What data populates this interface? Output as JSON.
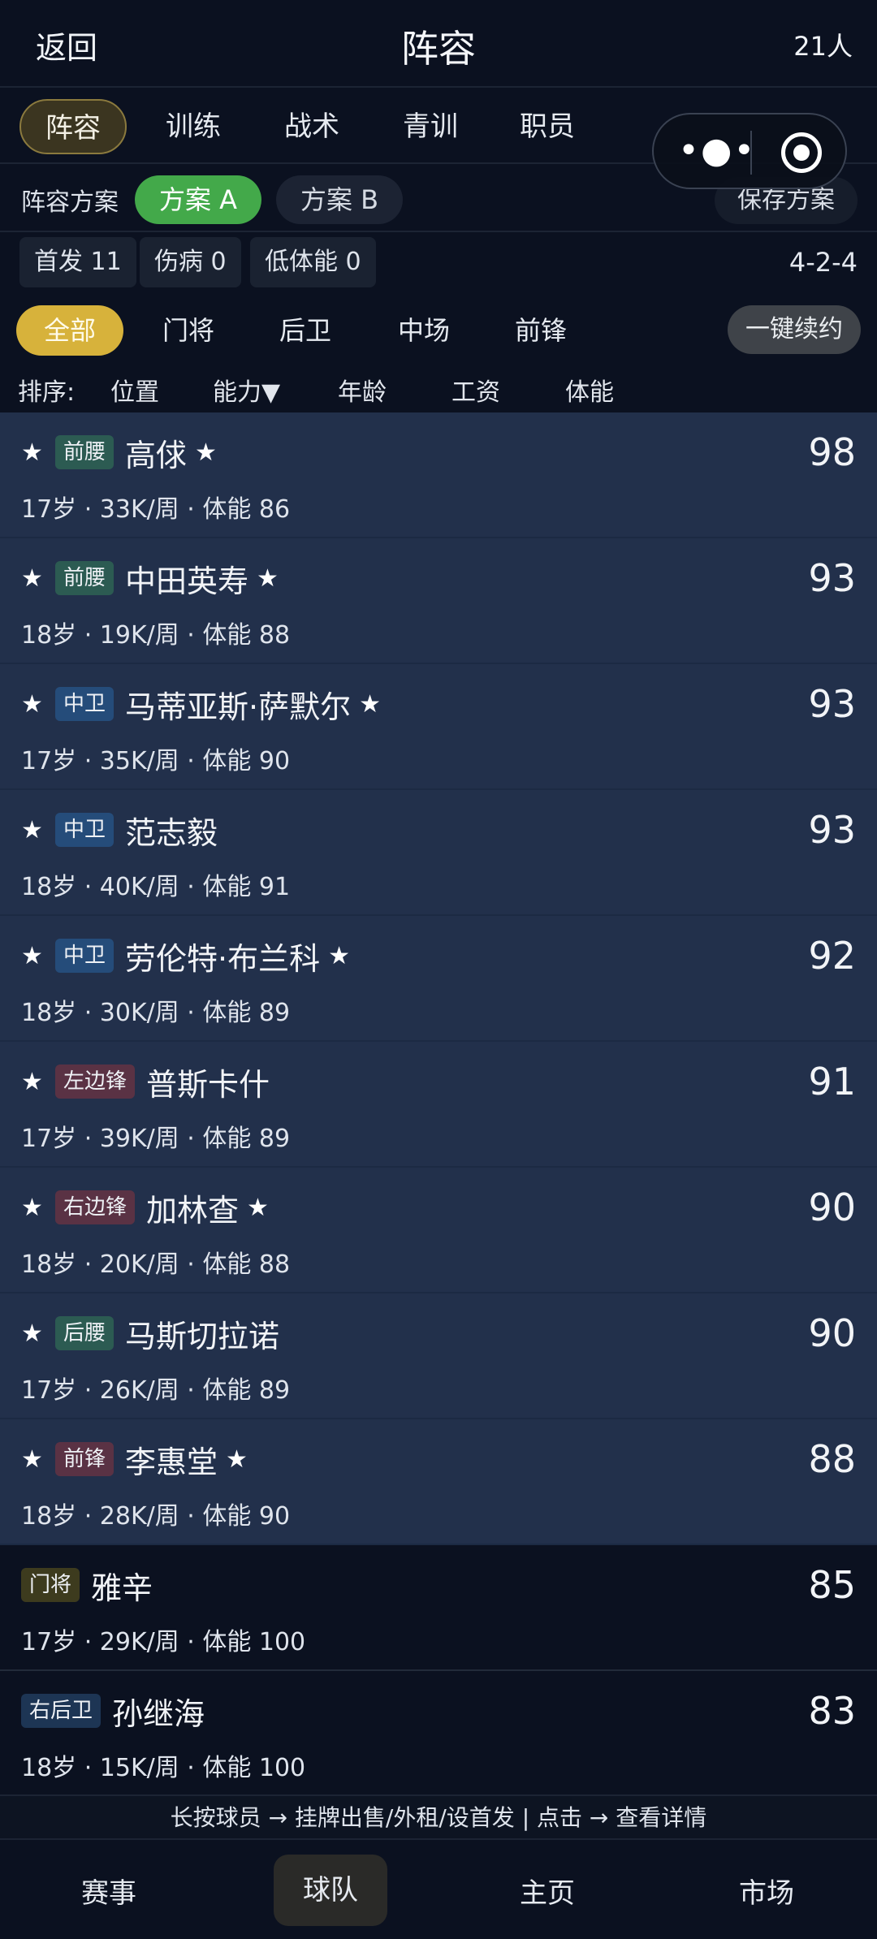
{
  "header": {
    "back_label": "返回",
    "title": "阵容",
    "count": "21人"
  },
  "tabs": [
    {
      "label": "阵容",
      "active": true
    },
    {
      "label": "训练"
    },
    {
      "label": "战术"
    },
    {
      "label": "青训"
    },
    {
      "label": "职员"
    }
  ],
  "plan": {
    "label": "阵容方案",
    "plan_a": "方案 A",
    "plan_b": "方案 B",
    "save": "保存方案"
  },
  "stats": {
    "starters": "首发 11",
    "injured": "伤病 0",
    "low_stamina": "低体能 0",
    "formation": "4-2-4"
  },
  "filters": {
    "all": "全部",
    "gk": "门将",
    "def": "后卫",
    "mid": "中场",
    "fwd": "前锋",
    "renew": "一键续约"
  },
  "sort": {
    "label": "排序:",
    "position": "位置",
    "ability": "能力▼",
    "age": "年龄",
    "wage": "工资",
    "stamina": "体能"
  },
  "players": [
    {
      "position": "前腰",
      "name": "高俅",
      "rating": "98",
      "info": "17岁 · 33K/周 · 体能 86"
    },
    {
      "position": "前腰",
      "name": "中田英寿",
      "rating": "93",
      "info": "18岁 · 19K/周 · 体能 88"
    },
    {
      "position": "中卫",
      "name": "马蒂亚斯·萨默尔",
      "rating": "93",
      "info": "17岁 · 35K/周 · 体能 90"
    },
    {
      "position": "中卫",
      "name": "范志毅",
      "rating": "93",
      "info": "18岁 · 40K/周 · 体能 91"
    },
    {
      "position": "中卫",
      "name": "劳伦特·布兰科",
      "rating": "92",
      "info": "18岁 · 30K/周 · 体能 89"
    },
    {
      "position": "左边锋",
      "name": "普斯卡什",
      "rating": "91",
      "info": "17岁 · 39K/周 · 体能 89"
    },
    {
      "position": "右边锋",
      "name": "加林查",
      "rating": "90",
      "info": "18岁 · 20K/周 · 体能 88"
    },
    {
      "position": "后腰",
      "name": "马斯切拉诺",
      "rating": "90",
      "info": "17岁 · 26K/周 · 体能 89"
    },
    {
      "position": "前锋",
      "name": "李惠堂",
      "rating": "88",
      "info": "18岁 · 28K/周 · 体能 90"
    },
    {
      "position": "门将",
      "name": "雅辛",
      "rating": "85",
      "info": "17岁 · 29K/周 · 体能 100"
    },
    {
      "position": "右后卫",
      "name": "孙继海",
      "rating": "83",
      "info": "18岁 · 15K/周 · 体能 100"
    }
  ],
  "hint": "长按球员 → 挂牌出售/外租/设首发 | 点击 → 查看详情",
  "bottom_nav": [
    {
      "label": "赛事"
    },
    {
      "label": "球队",
      "active": true
    },
    {
      "label": "主页"
    },
    {
      "label": "市场"
    }
  ],
  "star_symbol": "★",
  "colors": {
    "accent_gold": "#d7b23b",
    "plan_green": "#43a94a",
    "starter_bg": "#22304b",
    "page_bg": "#0b1120"
  }
}
